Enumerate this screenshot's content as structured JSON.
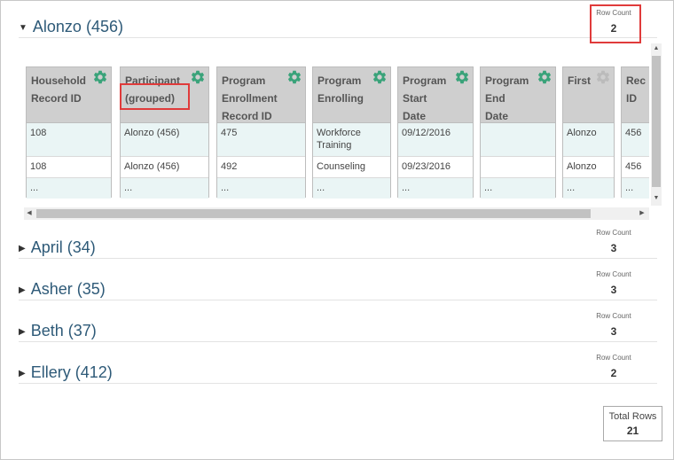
{
  "colors": {
    "accent": "#2e5a78",
    "gear": "#3aa37a",
    "gear_disabled": "#bbbbbb",
    "highlight": "#e03b3b",
    "row_tint": "#eaf5f5",
    "header_bg": "#cfcfcf"
  },
  "row_count_label": "Row Count",
  "groups": [
    {
      "name": "Alonzo (456)",
      "expanded": true,
      "row_count": "2"
    },
    {
      "name": "April (34)",
      "expanded": false,
      "row_count": "3"
    },
    {
      "name": "Asher (35)",
      "expanded": false,
      "row_count": "3"
    },
    {
      "name": "Beth (37)",
      "expanded": false,
      "row_count": "3"
    },
    {
      "name": "Ellery (412)",
      "expanded": false,
      "row_count": "2"
    }
  ],
  "columns": [
    {
      "header": "Household\nRecord ID",
      "gear": "gear-icon",
      "cells": [
        "108",
        "108",
        "..."
      ]
    },
    {
      "header": "Participant\n(grouped)",
      "gear": "gear-icon",
      "cells": [
        "Alonzo (456)",
        "Alonzo (456)",
        "..."
      ]
    },
    {
      "header": "Program\nEnrollment\nRecord ID",
      "gear": "gear-icon",
      "cells": [
        "475",
        "492",
        "..."
      ]
    },
    {
      "header": "Program\nEnrolling",
      "gear": "gear-icon",
      "cells": [
        "Workforce\nTraining",
        "Counseling",
        "..."
      ]
    },
    {
      "header": "Program\nStart\nDate",
      "gear": "gear-icon",
      "cells": [
        "09/12/2016",
        "09/23/2016",
        "..."
      ]
    },
    {
      "header": "Program\nEnd\nDate",
      "gear": "gear-icon",
      "cells": [
        "",
        "",
        "..."
      ]
    },
    {
      "header": "First",
      "gear": "gear-icon-disabled",
      "cells": [
        "Alonzo",
        "Alonzo",
        "..."
      ]
    },
    {
      "header": "Rec\nID",
      "gear": "gear-icon",
      "cells": [
        "456",
        "456",
        "..."
      ]
    }
  ],
  "total": {
    "label": "Total Rows",
    "value": "21"
  }
}
